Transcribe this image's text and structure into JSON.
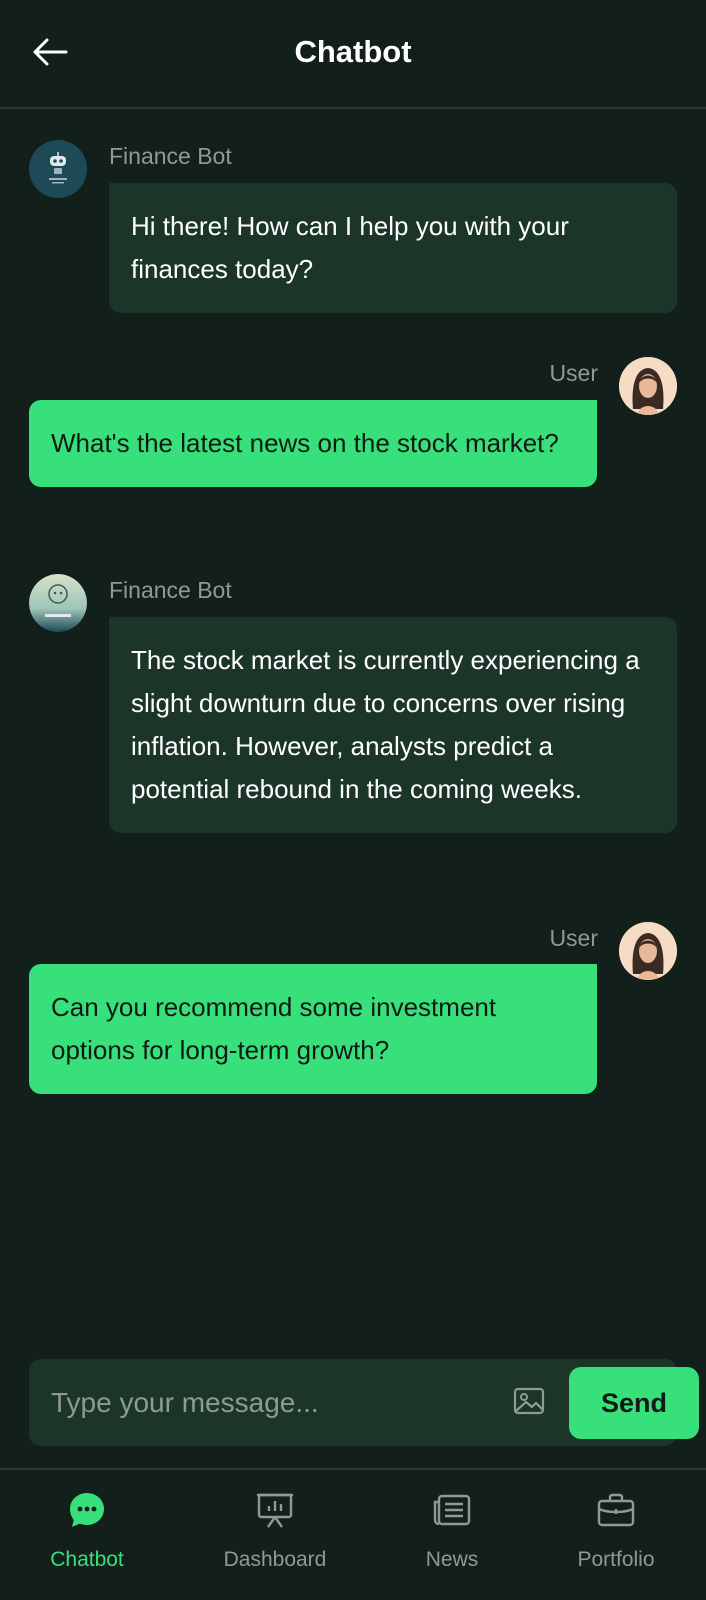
{
  "header": {
    "title": "Chatbot",
    "back_icon": "arrow-left-icon"
  },
  "messages": [
    {
      "sender": "bot",
      "name": "Finance Bot",
      "text": "Hi there! How can I help you with your finances today?",
      "avatar": "robot-avatar"
    },
    {
      "sender": "user",
      "name": "User",
      "text": "What's the latest news on the stock market?",
      "avatar": "user-avatar"
    },
    {
      "sender": "bot",
      "name": "Finance Bot",
      "text": "The stock market is currently experiencing a slight downturn due to concerns over rising inflation. However, analysts predict a potential rebound in the coming weeks.",
      "avatar": "robot-avatar"
    },
    {
      "sender": "user",
      "name": "User",
      "text": "Can you recommend some investment options for long-term growth?",
      "avatar": "user-avatar"
    }
  ],
  "composer": {
    "placeholder": "Type your message...",
    "value": "",
    "image_icon": "image-icon",
    "send_label": "Send"
  },
  "nav": {
    "items": [
      {
        "label": "Chatbot",
        "icon": "chat-bubble-icon",
        "active": true
      },
      {
        "label": "Dashboard",
        "icon": "presentation-chart-icon",
        "active": false
      },
      {
        "label": "News",
        "icon": "newspaper-icon",
        "active": false
      },
      {
        "label": "Portfolio",
        "icon": "briefcase-icon",
        "active": false
      }
    ]
  },
  "colors": {
    "background": "#131f1b",
    "bot_bubble": "#1b3529",
    "accent": "#38e07b",
    "muted_text": "#8f9a95"
  }
}
